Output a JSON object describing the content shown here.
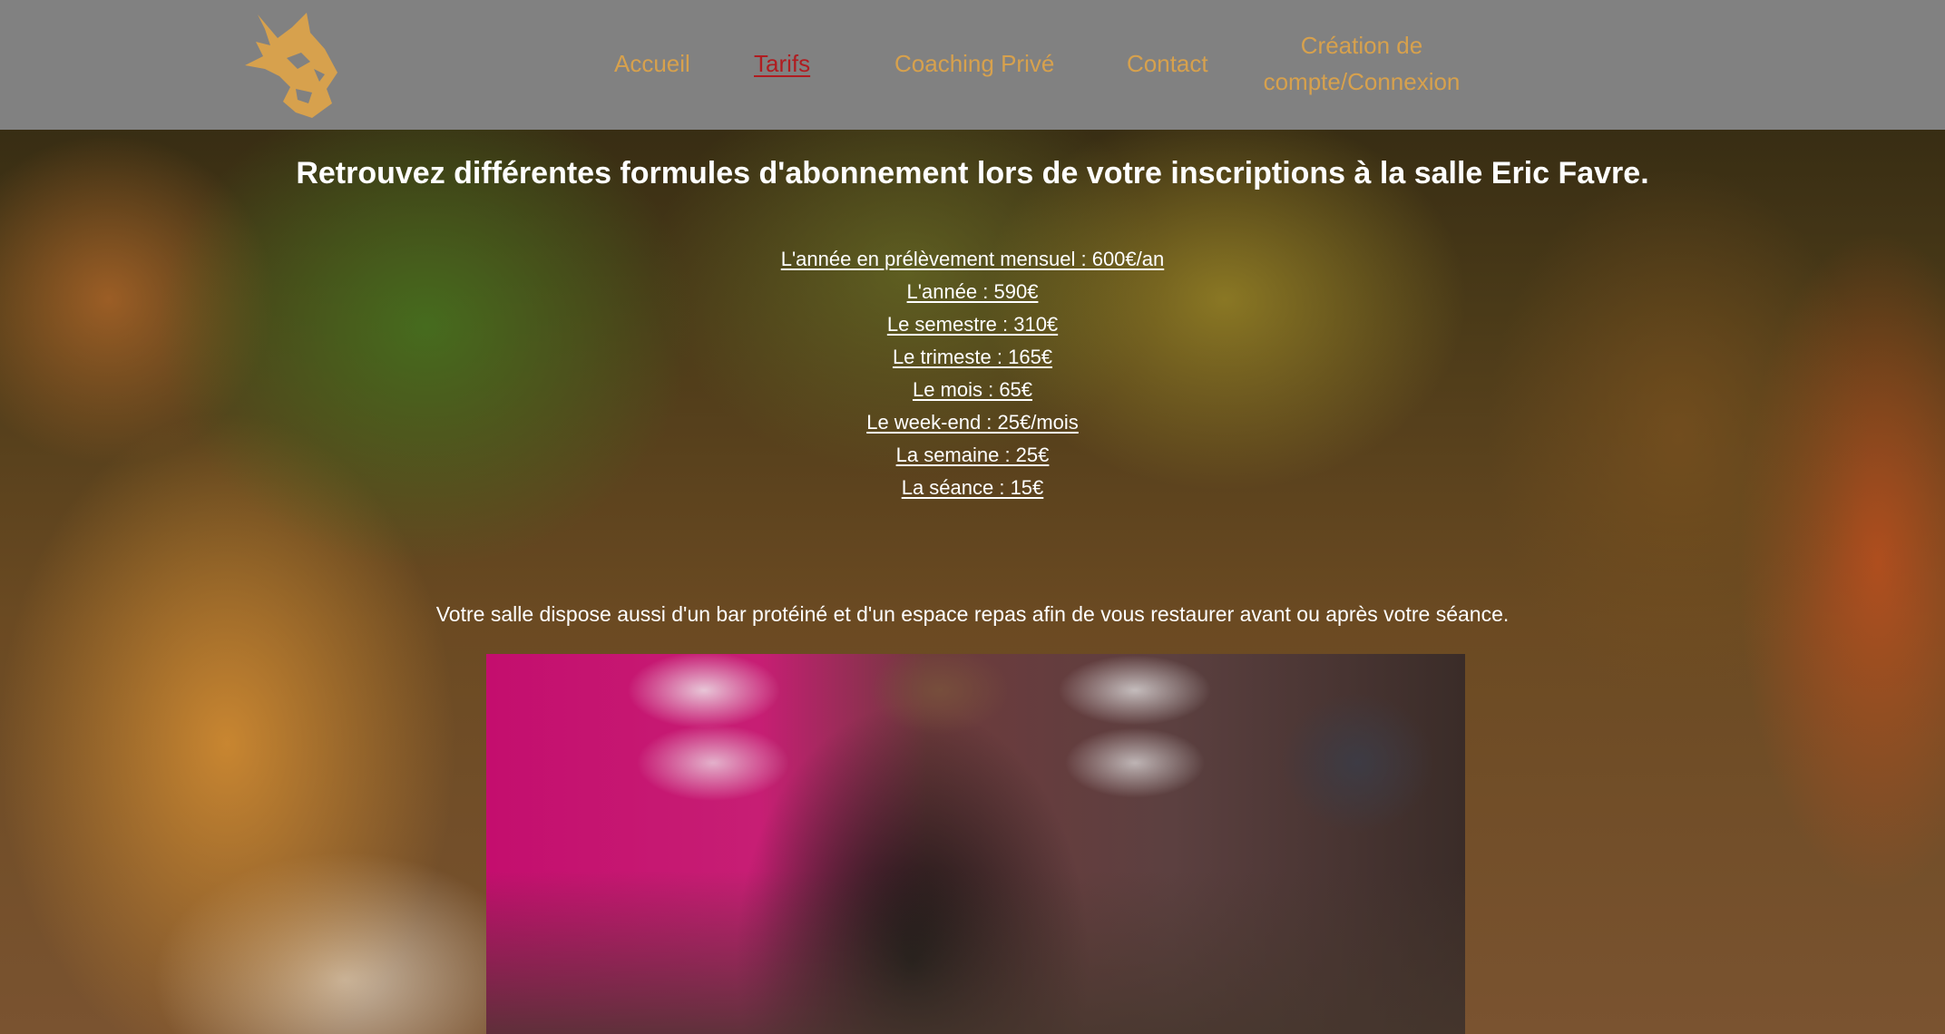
{
  "nav": {
    "logo_name": "lynx-logo",
    "links": [
      {
        "label": "Accueil",
        "active": false
      },
      {
        "label": "Tarifs",
        "active": true
      },
      {
        "label": "Coaching Privé",
        "active": false
      },
      {
        "label": "Contact",
        "active": false
      },
      {
        "label": "Création de compte/Connexion",
        "active": false
      }
    ],
    "colors": {
      "background": "#818181",
      "link": "#d7a14d",
      "active_link": "#b01c20"
    }
  },
  "main": {
    "headline": "Retrouvez différentes formules d'abonnement lors de votre inscriptions à la salle Eric Favre.",
    "prices": [
      "L'année en prélèvement mensuel : 600€/an",
      "L'année : 590€",
      "Le semestre : 310€",
      "Le trimeste : 165€",
      "Le mois : 65€",
      "Le week-end : 25€/mois",
      "La semaine : 25€",
      "La séance : 15€"
    ],
    "info": "Votre salle dispose aussi d'un bar protéiné et d'un espace repas afin de vous restaurer avant ou après votre séance."
  }
}
